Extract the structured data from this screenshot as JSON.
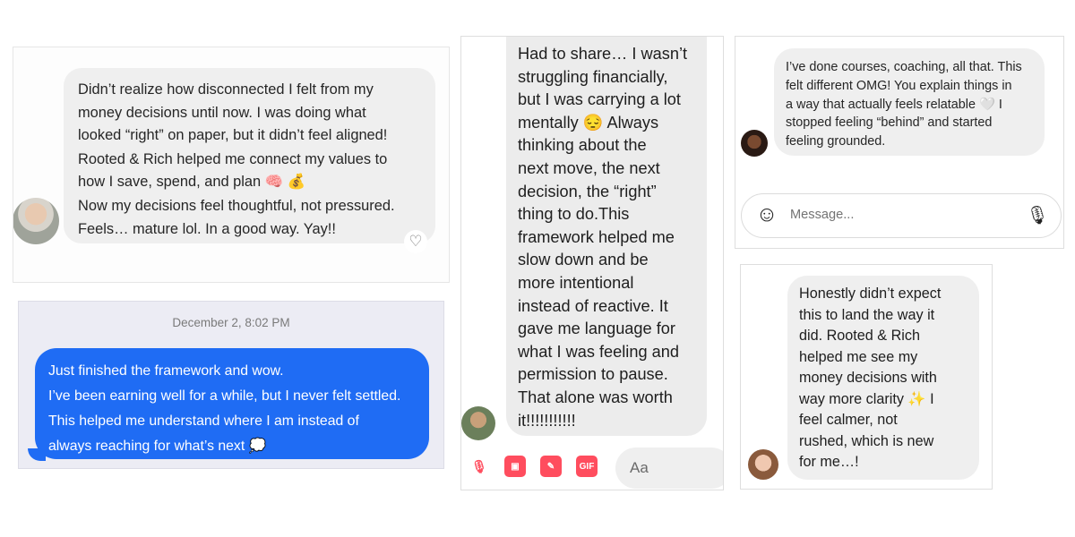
{
  "card1": {
    "paragraphs": [
      "Didn’t realize how disconnected I felt from my\nmoney decisions until now. I was doing what\nlooked “right” on paper, but it didn’t feel aligned!",
      "Rooted & Rich helped me connect my values to\nhow I save, spend, and plan 🧠 💰",
      "Now my decisions feel thoughtful, not pressured.\nFeels… mature lol. In a good way. Yay!!"
    ],
    "heart_icon": "♡"
  },
  "card2": {
    "timestamp": "December 2, 8:02 PM",
    "paragraphs": [
      "Just finished the framework and wow.",
      "I’ve been earning well for a while, but I never felt settled.",
      "This helped me understand where I am instead of\nalways reaching for what’s next 💭"
    ]
  },
  "card3": {
    "message": "Had to share… I wasn’t\nstruggling financially,\nbut I was carrying a lot\nmentally 😔 Always\nthinking about the\nnext move, the next\ndecision, the “right”\nthing to do.This\nframework helped me\nslow down and be\nmore intentional\ninstead of reactive. It\ngave me language for\nwhat I was feeling and\npermission to pause.\nThat alone was worth\nit!!!!!!!!!!!",
    "toolbar": {
      "mic_icon": "🎙",
      "gallery_icon": "▣",
      "sticker_icon": "✎",
      "gif_label": "GIF"
    },
    "compose_placeholder": "Aa",
    "accent_color": "#ff4d5e"
  },
  "card4": {
    "message": "I’ve done courses, coaching, all that. This\nfelt different OMG! You explain things in\na way that actually feels relatable 🤍 I\nstopped feeling “behind” and started\nfeeling grounded.",
    "message_placeholder": "Message...",
    "emoji_icon": "☺",
    "mic_icon": "🎙"
  },
  "card5": {
    "message": "Honestly didn’t expect\nthis to land the way it\ndid. Rooted & Rich\nhelped me see my\nmoney decisions with\nway more clarity ✨ I\nfeel calmer, not\nrushed, which is new\nfor me…!"
  },
  "colors": {
    "imessage_blue": "#1f6cf4",
    "bubble_gray": "#efefef"
  }
}
